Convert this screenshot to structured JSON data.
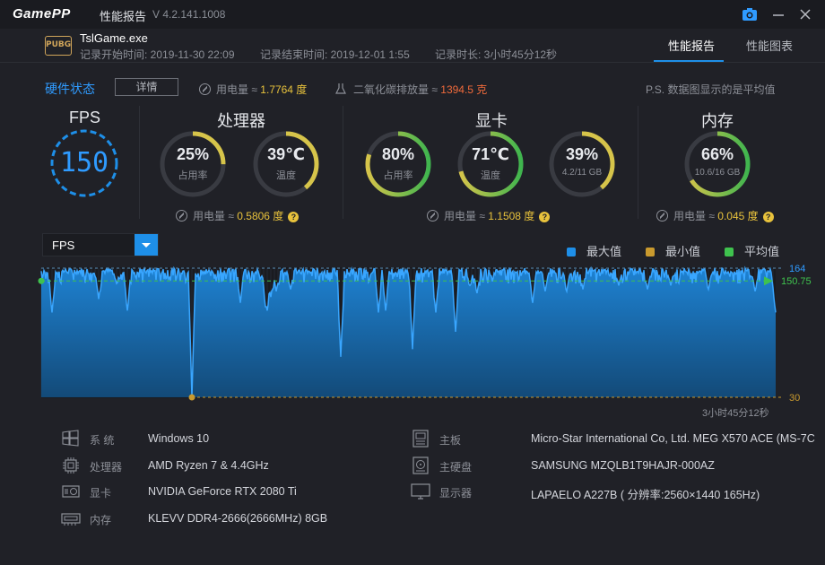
{
  "titlebar": {
    "logo": "GamePP",
    "title": "性能报告",
    "version": "V 4.2.141.1008"
  },
  "header": {
    "game_logo": "PUBG",
    "game_name": "TslGame.exe",
    "record_start": "记录开始时间: 2019-11-30 22:09",
    "record_end": "记录结束时间: 2019-12-01 1:55",
    "record_duration": "记录时长: 3小时45分12秒",
    "tabs": [
      "性能报告",
      "性能图表"
    ]
  },
  "hardware": {
    "title": "硬件状态",
    "details_button": "详情",
    "power_label": "用电量 ≈",
    "power_value": "1.7764 度",
    "co2_label": "二氧化碳排放量 ≈",
    "co2_value": "1394.5 克",
    "note": "P.S. 数据图显示的是平均值"
  },
  "fps": {
    "title": "FPS",
    "value": "150"
  },
  "cpu": {
    "title": "处理器",
    "usage": {
      "value": "25%",
      "label": "占用率",
      "fraction": 0.25
    },
    "temp": {
      "value": "39℃",
      "label": "温度",
      "fraction": 0.39
    },
    "power_label": "用电量 ≈",
    "power_value": "0.5806 度"
  },
  "gpu": {
    "title": "显卡",
    "usage": {
      "value": "80%",
      "label": "占用率",
      "fraction": 0.8
    },
    "temp": {
      "value": "71℃",
      "label": "温度",
      "fraction": 0.71
    },
    "vram": {
      "value": "39%",
      "label": "4.2/11 GB",
      "fraction": 0.39
    },
    "power_label": "用电量 ≈",
    "power_value": "1.1508 度"
  },
  "memory": {
    "title": "内存",
    "usage": {
      "value": "66%",
      "label": "10.6/16 GB",
      "fraction": 0.66
    },
    "power_label": "用电量 ≈",
    "power_value": "0.045 度"
  },
  "chart": {
    "selector": "FPS",
    "legend": [
      {
        "label": "最大值",
        "color": "#1e8fe8"
      },
      {
        "label": "最小值",
        "color": "#c99a2e"
      },
      {
        "label": "平均值",
        "color": "#3fc24e"
      }
    ],
    "duration": "3小时45分12秒"
  },
  "chart_data": {
    "type": "area",
    "max_label": "164",
    "avg_label": "150.75",
    "min_label": "30",
    "ylim": [
      30,
      164
    ],
    "max": 164,
    "avg": 150.75,
    "min": 30
  },
  "specs": [
    {
      "icon": "windows-icon",
      "label": "系    统",
      "value": "Windows 10"
    },
    {
      "icon": "cpu-icon",
      "label": "处理器",
      "value": "AMD Ryzen 7 & 4.4GHz"
    },
    {
      "icon": "gpu-icon",
      "label": "显卡",
      "value": "NVIDIA GeForce RTX 2080 Ti"
    },
    {
      "icon": "ram-icon",
      "label": "内存",
      "value": "KLEVV DDR4-2666(2666MHz) 8GB"
    },
    {
      "icon": "motherboard-icon",
      "label": "主板",
      "value": "Micro-Star International Co, Ltd. MEG X570 ACE (MS-7C"
    },
    {
      "icon": "harddisk-icon",
      "label": "主硬盘",
      "value": "SAMSUNG MZQLB1T9HAJR-000AZ"
    },
    {
      "icon": "monitor-icon",
      "label": "显示器",
      "value": "LAPAELO A227B ( 分辨率:2560×1440 165Hz)"
    }
  ]
}
